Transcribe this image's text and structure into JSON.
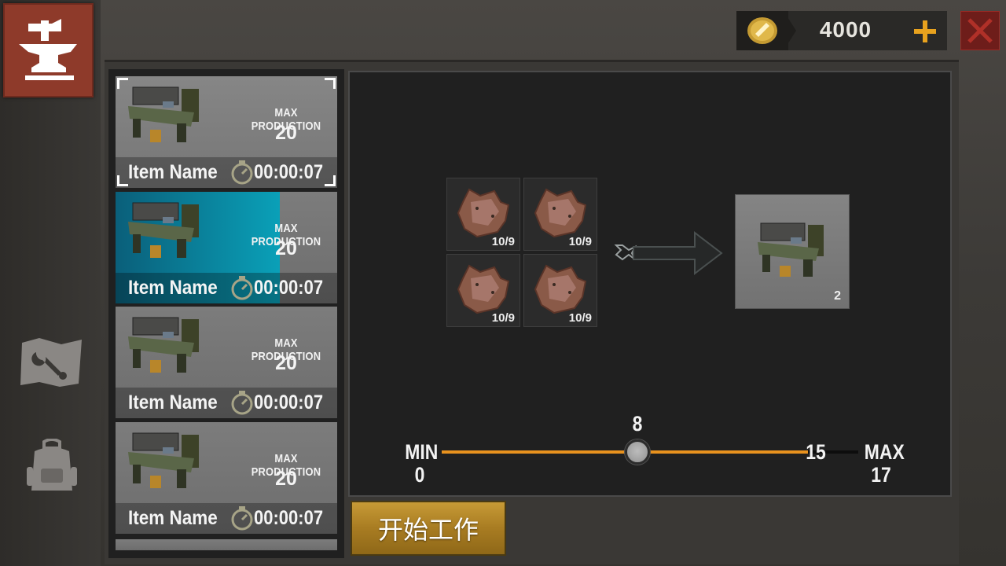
{
  "currency": {
    "amount": "4000",
    "icon": "gold-coin-icon"
  },
  "rail": {
    "tabs": [
      "forge-anvil-icon",
      "repair-wrench-icon",
      "backpack-icon"
    ]
  },
  "recipes": [
    {
      "max_label": "MAX PRODUCTION",
      "max_value": "20",
      "name": "Item Name",
      "time": "00:00:07",
      "selected": true,
      "progress": 0
    },
    {
      "max_label": "MAX PRODUCTION",
      "max_value": "20",
      "name": "Item Name",
      "time": "00:00:07",
      "selected": false,
      "progress": 0.74
    },
    {
      "max_label": "MAX PRODUCTION",
      "max_value": "20",
      "name": "Item Name",
      "time": "00:00:07",
      "selected": false,
      "progress": 0
    },
    {
      "max_label": "MAX PRODUCTION",
      "max_value": "20",
      "name": "Item Name",
      "time": "00:00:07",
      "selected": false,
      "progress": 0
    }
  ],
  "materials": [
    {
      "count": "10/9"
    },
    {
      "count": "10/9"
    },
    {
      "count": "10/9"
    },
    {
      "count": "10/9"
    }
  ],
  "result": {
    "count": "2"
  },
  "slider": {
    "min_label": "MIN",
    "min_value": "0",
    "max_label": "MAX",
    "max_value": "17",
    "current": "8",
    "cap": "15",
    "current_fraction": 0.47,
    "cap_fraction": 0.88
  },
  "start_button": {
    "label": "开始工作"
  },
  "colors": {
    "accent": "#e8921e",
    "close": "#6e1d1a",
    "forge_tab": "#8e3a2a",
    "button": "#c79a36"
  }
}
